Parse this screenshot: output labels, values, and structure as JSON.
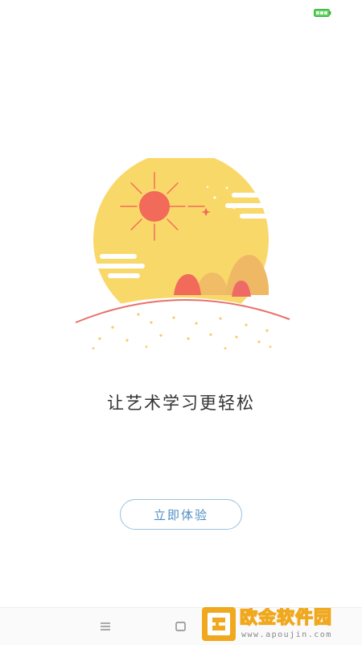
{
  "status_bar": {
    "battery_icon": "battery-icon",
    "battery_level": 1.0,
    "battery_color": "#5ad05a"
  },
  "illustration": {
    "icon": "sun-mountain-illustration",
    "sun_disc_color": "#f9d86a",
    "sun_color": "#f26a5a",
    "mountain_colors": [
      "#f26a5a",
      "#efb865",
      "#ee6a66"
    ],
    "horizon_color": "#e9716a",
    "cloud_color": "#ffffff"
  },
  "tagline": "让艺术学习更轻松",
  "start_button": {
    "label": "立即体验",
    "border_color": "#9cc0dc",
    "text_color": "#4f8fc4"
  },
  "nav_bar": {
    "menu_icon": "menu-icon",
    "home_icon": "home-square-icon"
  },
  "watermark": {
    "logo_icon": "watermark-logo-icon",
    "title": "欧金软件园",
    "url": "www.apoujin.com",
    "accent_color": "#f0a81e"
  }
}
